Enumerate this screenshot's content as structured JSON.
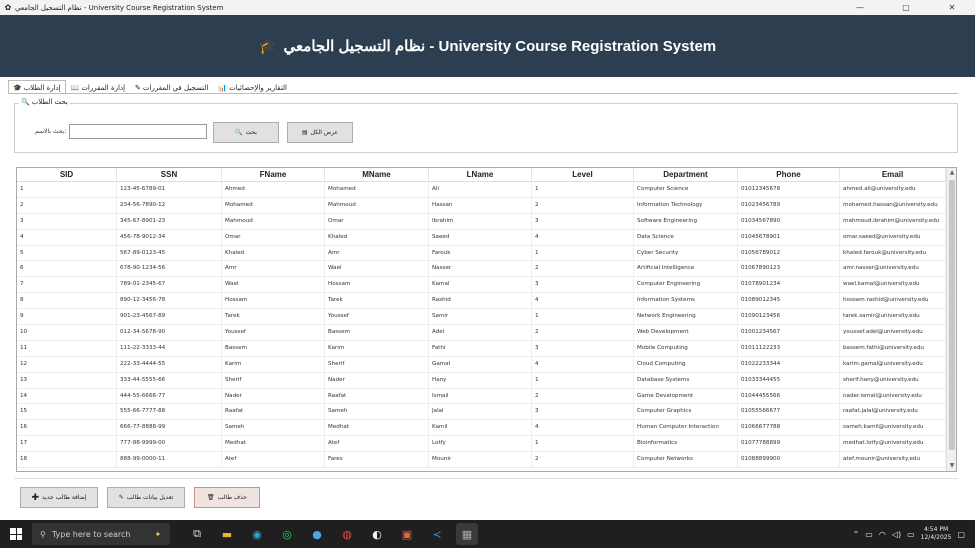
{
  "window": {
    "title": "نظام التسجيل الجامعي - University Course Registration System",
    "minimize": "—",
    "maximize": "▢",
    "close": "✕"
  },
  "header": {
    "title": "University Course Registration System - نظام التسجيل الجامعي",
    "icon": "🎓"
  },
  "tabs": [
    {
      "label": "إدارة الطلاب",
      "icon": "🎓"
    },
    {
      "label": "إدارة المقررات",
      "icon": "📖"
    },
    {
      "label": "التسجيل في المقررات",
      "icon": "✎"
    },
    {
      "label": "التقارير والإحصائيات",
      "icon": "📊"
    }
  ],
  "search": {
    "group_title": "بحث الطلاب",
    "label": "بحث بالاسم:",
    "value": "",
    "search_btn": "بحث",
    "showall_btn": "عرض الكل"
  },
  "grid": {
    "columns": [
      "SID",
      "SSN",
      "FName",
      "MName",
      "LName",
      "Level",
      "Department",
      "Phone",
      "Email"
    ],
    "rows": [
      [
        "1",
        "123-45-6789-01",
        "Ahmed",
        "Mohamed",
        "Ali",
        "1",
        "Computer Science",
        "01012345678",
        "ahmed.ali@university.edu"
      ],
      [
        "2",
        "234-56-7890-12",
        "Mohamed",
        "Mahmoud",
        "Hassan",
        "2",
        "Information Technology",
        "01023456789",
        "mohamed.hassan@university.edu"
      ],
      [
        "3",
        "345-67-8901-23",
        "Mahmoud",
        "Omar",
        "Ibrahim",
        "3",
        "Software Engineering",
        "01034567890",
        "mahmoud.ibrahim@university.edu"
      ],
      [
        "4",
        "456-78-9012-34",
        "Omar",
        "Khaled",
        "Saeed",
        "4",
        "Data Science",
        "01045678901",
        "omar.saeed@university.edu"
      ],
      [
        "5",
        "567-89-0123-45",
        "Khaled",
        "Amr",
        "Farouk",
        "1",
        "Cyber Security",
        "01056789012",
        "khaled.farouk@university.edu"
      ],
      [
        "6",
        "678-90-1234-56",
        "Amr",
        "Wael",
        "Nasser",
        "2",
        "Artificial Intelligence",
        "01067890123",
        "amr.nasser@university.edu"
      ],
      [
        "7",
        "789-01-2345-67",
        "Wael",
        "Hossam",
        "Kamal",
        "3",
        "Computer Engineering",
        "01078901234",
        "wael.kamal@university.edu"
      ],
      [
        "8",
        "890-12-3456-78",
        "Hossam",
        "Tarek",
        "Rashid",
        "4",
        "Information Systems",
        "01089012345",
        "hossam.rashid@university.edu"
      ],
      [
        "9",
        "901-23-4567-89",
        "Tarek",
        "Youssef",
        "Samir",
        "1",
        "Network Engineering",
        "01090123456",
        "tarek.samir@university.edu"
      ],
      [
        "10",
        "012-34-5678-90",
        "Youssef",
        "Bassem",
        "Adel",
        "2",
        "Web Development",
        "01001234567",
        "youssef.adel@university.edu"
      ],
      [
        "11",
        "111-22-3333-44",
        "Bassem",
        "Karim",
        "Fathi",
        "3",
        "Mobile Computing",
        "01011122233",
        "bassem.fathi@university.edu"
      ],
      [
        "12",
        "222-33-4444-55",
        "Karim",
        "Sherif",
        "Gamal",
        "4",
        "Cloud Computing",
        "01022233344",
        "karim.gamal@university.edu"
      ],
      [
        "13",
        "333-44-5555-66",
        "Sherif",
        "Nader",
        "Hany",
        "1",
        "Database Systems",
        "01033344455",
        "sherif.hany@university.edu"
      ],
      [
        "14",
        "444-55-6666-77",
        "Nader",
        "Raafat",
        "Ismail",
        "2",
        "Game Development",
        "01044455566",
        "nader.ismail@university.edu"
      ],
      [
        "15",
        "555-66-7777-88",
        "Raafat",
        "Sameh",
        "Jalal",
        "3",
        "Computer Graphics",
        "01055566677",
        "raafat.jalal@university.edu"
      ],
      [
        "16",
        "666-77-8888-99",
        "Sameh",
        "Medhat",
        "Kamil",
        "4",
        "Human Computer Interaction",
        "01066677788",
        "sameh.kamil@university.edu"
      ],
      [
        "17",
        "777-88-9999-00",
        "Medhat",
        "Atef",
        "Lotfy",
        "1",
        "Bioinformatics",
        "01077788899",
        "medhat.lotfy@university.edu"
      ],
      [
        "18",
        "888-99-0000-11",
        "Atef",
        "Fares",
        "Mounir",
        "2",
        "Computer Networks",
        "01088899900",
        "atef.mounir@university.edu"
      ]
    ]
  },
  "actions": {
    "add": "إضافة طالب جديد",
    "edit": "تعديل بيانات طالب",
    "delete": "حذف طالب"
  },
  "taskbar": {
    "search_placeholder": "Type here to search",
    "time": "4:54 PM",
    "date": "12/4/2025"
  }
}
